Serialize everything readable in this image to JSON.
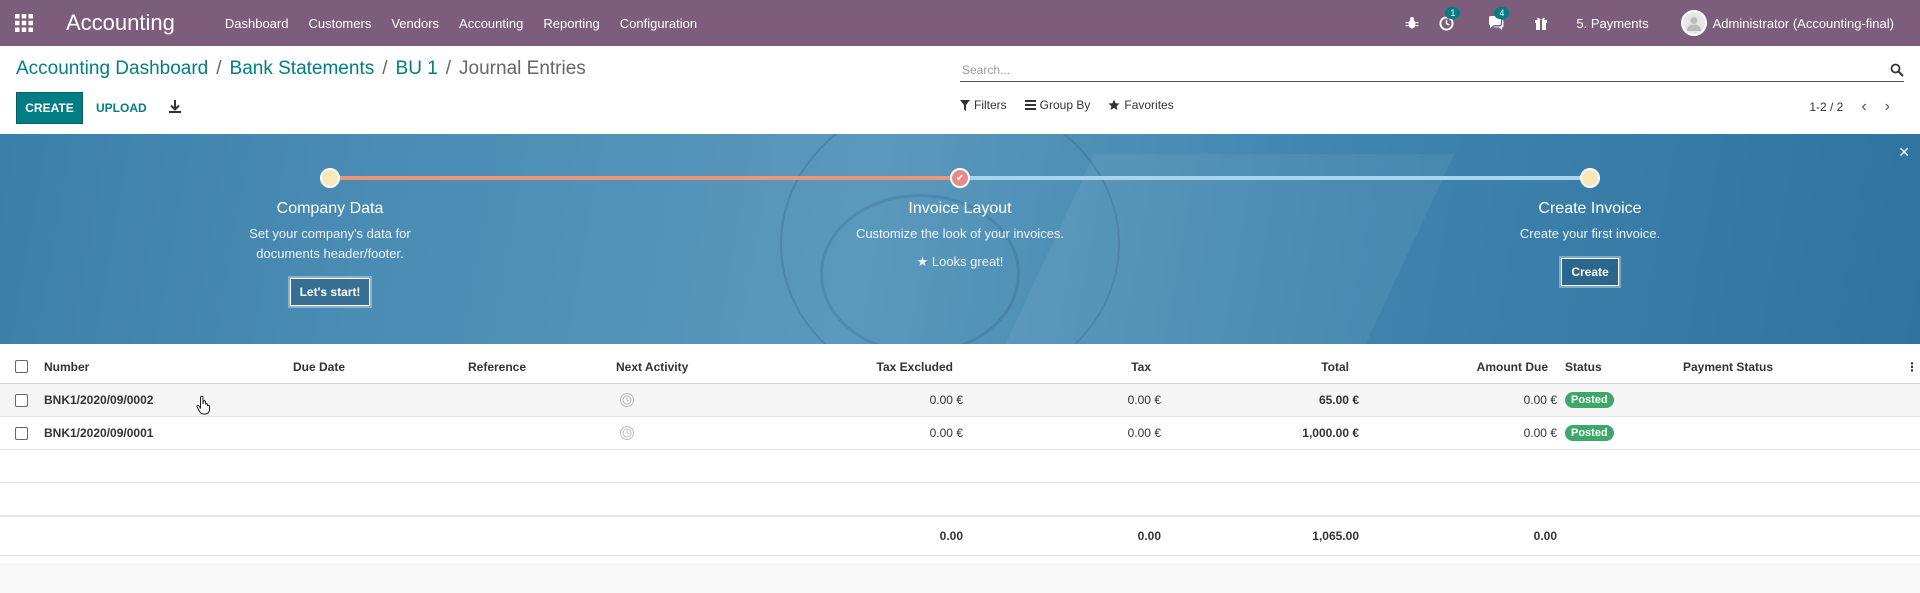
{
  "navbar": {
    "app_title": "Accounting",
    "menu": [
      "Dashboard",
      "Customers",
      "Vendors",
      "Accounting",
      "Reporting",
      "Configuration"
    ],
    "activity_count": "1",
    "messages_count": "4",
    "company_label": "5. Payments",
    "user_label": "Administrator (Accounting-final)",
    "icons": [
      "apps-grid-icon",
      "bug-icon",
      "clock-activity-icon",
      "chat-icon",
      "gift-icon"
    ]
  },
  "breadcrumb": {
    "items": [
      "Accounting Dashboard",
      "Bank Statements",
      "BU 1"
    ],
    "separator": "/",
    "active": "Journal Entries"
  },
  "search": {
    "placeholder": "Search..."
  },
  "toolbar": {
    "create_label": "CREATE",
    "upload_label": "UPLOAD"
  },
  "filters": {
    "filters_label": "Filters",
    "groupby_label": "Group By",
    "favorites_label": "Favorites"
  },
  "pager": {
    "value": "1-2 / 2"
  },
  "banner": {
    "steps": [
      {
        "title": "Company Data",
        "text_line1": "Set your company's data for",
        "text_line2": "documents header/footer.",
        "button": "Let's start!"
      },
      {
        "title": "Invoice Layout",
        "text_line1": "Customize the look of your invoices.",
        "done_text": "Looks great!"
      },
      {
        "title": "Create Invoice",
        "text_line1": "Create your first invoice.",
        "button": "Create"
      }
    ]
  },
  "table": {
    "columns": [
      "Number",
      "Due Date",
      "Reference",
      "Next Activity",
      "Tax Excluded",
      "Tax",
      "Total",
      "Amount Due",
      "Status",
      "Payment Status"
    ],
    "rows": [
      {
        "number": "BNK1/2020/09/0002",
        "tax_excluded": "0.00 €",
        "tax": "0.00 €",
        "total": "65.00 €",
        "amount_due": "0.00 €",
        "status": "Posted"
      },
      {
        "number": "BNK1/2020/09/0001",
        "tax_excluded": "0.00 €",
        "tax": "0.00 €",
        "total": "1,000.00 €",
        "amount_due": "0.00 €",
        "status": "Posted"
      }
    ],
    "totals": {
      "tax_excluded": "0.00",
      "tax": "0.00",
      "total": "1,065.00",
      "amount_due": "0.00"
    }
  },
  "colors": {
    "navbar": "#7c5d7c",
    "primary": "#017e84",
    "posted": "#3ea76a"
  }
}
